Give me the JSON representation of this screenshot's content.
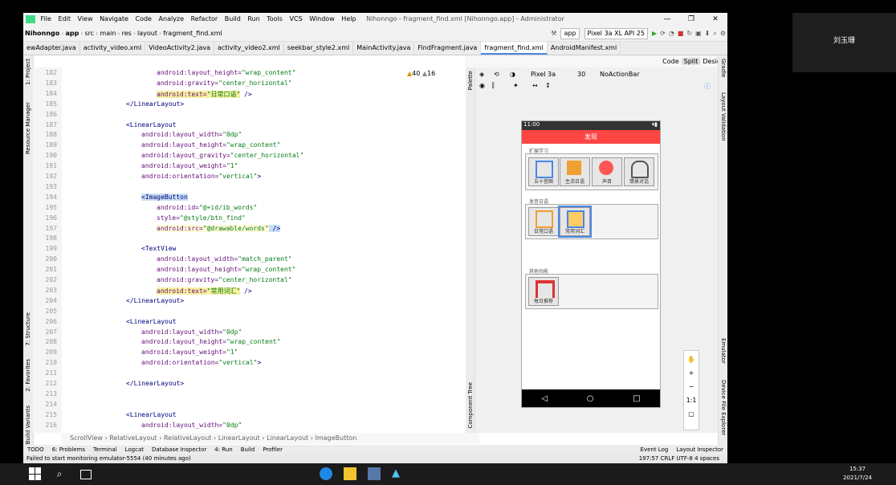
{
  "window": {
    "title": "Nihonngo - fragment_find.xml [Nihonngo.app] - Administrator",
    "menu": [
      "File",
      "Edit",
      "View",
      "Navigate",
      "Code",
      "Analyze",
      "Refactor",
      "Build",
      "Run",
      "Tools",
      "VCS",
      "Window",
      "Help"
    ]
  },
  "breadcrumbs": [
    "Nihonngo",
    "app",
    "src",
    "main",
    "res",
    "layout",
    "fragment_find.xml"
  ],
  "toolbar": {
    "module": "app",
    "device": "Pixel 3a XL API 25"
  },
  "tabs": [
    "ewAdapter.java",
    "activity_video.xml",
    "VideoActivity2.java",
    "activity_video2.xml",
    "seekbar_style2.xml",
    "MainActivity.java",
    "FindFragment.java",
    "fragment_find.xml",
    "AndroidManifest.xml"
  ],
  "active_tab": "fragment_find.xml",
  "view_modes": [
    "Code",
    "Split",
    "Design"
  ],
  "left_tools": [
    "1: Project",
    "Resource Manager",
    "7: Structure",
    "2: Favorites",
    "Build Variants"
  ],
  "right_tools": [
    "Gradle",
    "Layout Validation",
    "Emulator",
    "Device File Explorer"
  ],
  "inspections": {
    "warnings": "40",
    "weak": "16"
  },
  "line_numbers": [
    "182",
    "183",
    "184",
    "185",
    "186",
    "187",
    "188",
    "189",
    "190",
    "191",
    "192",
    "193",
    "194",
    "195",
    "196",
    "197",
    "198",
    "199",
    "200",
    "201",
    "202",
    "203",
    "204",
    "205",
    "206",
    "207",
    "208",
    "209",
    "210",
    "211",
    "212",
    "213",
    "214",
    "215",
    "216"
  ],
  "code_lines": [
    {
      "indent": 6,
      "attr": "android:layout_height=",
      "val": "\"wrap_content\""
    },
    {
      "indent": 6,
      "attr": "android:gravity=",
      "val": "\"center_horizontal\""
    },
    {
      "indent": 6,
      "attr": "android:text=",
      "val": "\"日常口语\"",
      "tail": " />",
      "hl": true
    },
    {
      "indent": 4,
      "tag": "</LinearLayout>"
    },
    {
      "indent": 0,
      "tag": ""
    },
    {
      "indent": 4,
      "tag": "<LinearLayout"
    },
    {
      "indent": 5,
      "attr": "android:layout_width=",
      "val": "\"0dp\""
    },
    {
      "indent": 5,
      "attr": "android:layout_height=",
      "val": "\"wrap_content\""
    },
    {
      "indent": 5,
      "attr": "android:layout_gravity=",
      "val": "\"center_horizontal\""
    },
    {
      "indent": 5,
      "attr": "android:layout_weight=",
      "val": "\"1\""
    },
    {
      "indent": 5,
      "attr": "android:orientation=",
      "val": "\"vertical\"",
      "tail": ">"
    },
    {
      "indent": 0,
      "tag": ""
    },
    {
      "indent": 5,
      "tag": "<ImageButton",
      "hl2": true
    },
    {
      "indent": 6,
      "attr": "android:id=",
      "val": "\"@+id/ib_words\""
    },
    {
      "indent": 6,
      "attr": "style=",
      "val": "\"@style/btn_find\""
    },
    {
      "indent": 6,
      "attr": "android:src=",
      "val": "\"@drawable/words\"",
      "tail": " />",
      "current": true
    },
    {
      "indent": 0,
      "tag": ""
    },
    {
      "indent": 5,
      "tag": "<TextView"
    },
    {
      "indent": 6,
      "attr": "android:layout_width=",
      "val": "\"match_parent\""
    },
    {
      "indent": 6,
      "attr": "android:layout_height=",
      "val": "\"wrap_content\""
    },
    {
      "indent": 6,
      "attr": "android:gravity=",
      "val": "\"center_horizontal\""
    },
    {
      "indent": 6,
      "attr": "android:text=",
      "val": "\"常用词汇\"",
      "tail": " />",
      "hl": true
    },
    {
      "indent": 4,
      "tag": "</LinearLayout>"
    },
    {
      "indent": 0,
      "tag": ""
    },
    {
      "indent": 4,
      "tag": "<LinearLayout"
    },
    {
      "indent": 5,
      "attr": "android:layout_width=",
      "val": "\"0dp\""
    },
    {
      "indent": 5,
      "attr": "android:layout_height=",
      "val": "\"wrap_content\""
    },
    {
      "indent": 5,
      "attr": "android:layout_weight=",
      "val": "\"1\""
    },
    {
      "indent": 5,
      "attr": "android:orientation=",
      "val": "\"vertical\"",
      "tail": ">"
    },
    {
      "indent": 0,
      "tag": ""
    },
    {
      "indent": 4,
      "tag": "</LinearLayout>"
    },
    {
      "indent": 0,
      "tag": ""
    },
    {
      "indent": 0,
      "tag": ""
    },
    {
      "indent": 4,
      "tag": "<LinearLayout"
    },
    {
      "indent": 5,
      "attr": "android:layout_width=",
      "val": "\"0dp\""
    }
  ],
  "design_toolbar": {
    "device": "Pixel 3a",
    "api": "30",
    "theme": "NoActionBar"
  },
  "phone": {
    "time": "11:00",
    "title": "发现",
    "sections": [
      {
        "label": "扩展学习",
        "buttons": [
          "五十音图",
          "生活日语",
          "声目",
          "情景对话"
        ]
      },
      {
        "label": "发音日语",
        "buttons": [
          "日常口语",
          "常用词汇"
        ]
      },
      {
        "label": "其他功能",
        "buttons": [
          "每日推荐"
        ]
      }
    ]
  },
  "component_tree_label": "Component Tree",
  "palette_label": "Palette",
  "layout_breadcrumb": [
    "ScrollView",
    "RelativeLayout",
    "RelativeLayout",
    "LinearLayout",
    "LinearLayout",
    "ImageButton"
  ],
  "bottom_tools": [
    "TODO",
    "6: Problems",
    "Terminal",
    "Logcat",
    "Database Inspector",
    "4: Run",
    "Build",
    "Profiler",
    "Event Log",
    "Layout Inspector"
  ],
  "status": {
    "message": "Failed to start monitoring emulator-5554 (40 minutes ago)",
    "position": "197:57",
    "line_ending": "CRLF",
    "encoding": "UTF-8",
    "indent": "4 spaces"
  },
  "taskbar": {
    "time": "15:37",
    "date": "2021/7/24"
  },
  "video_caller": "刘玉珊",
  "colors": {
    "accent": "#4a86e8",
    "phone_title": "#ff4444"
  }
}
